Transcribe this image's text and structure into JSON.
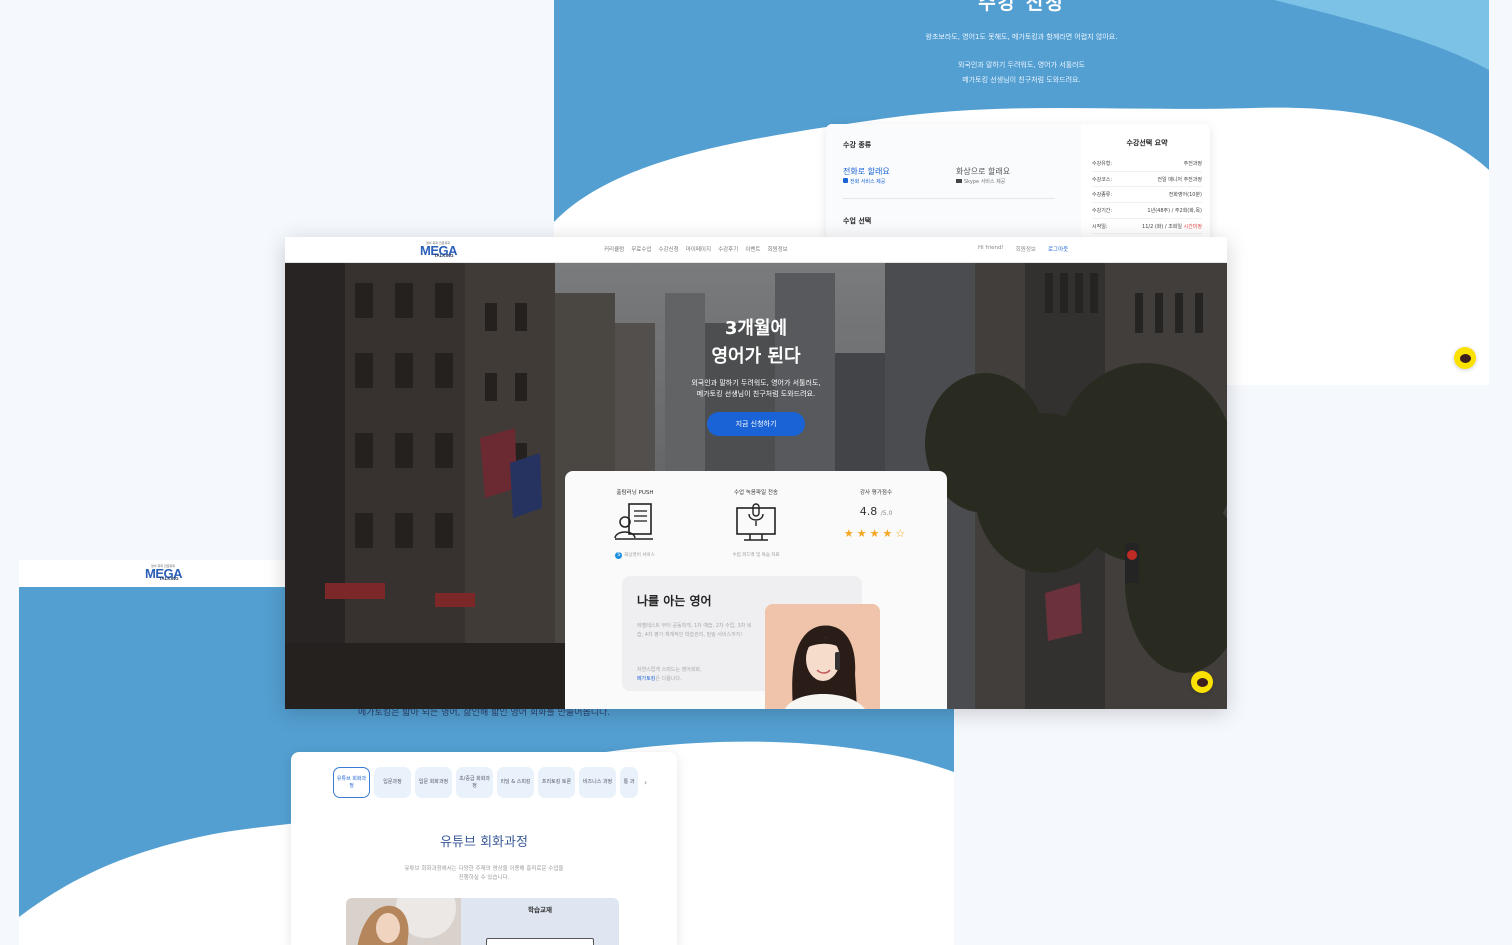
{
  "registration": {
    "title": "수강 신청",
    "subtitle1": "왕초보라도, 영어1도 못해도, 메가토킹과 함께라면 어렵지 않아요.",
    "subtitle2_line1": "외국인과 말하기 두려워도, 영어가 서툴러도",
    "subtitle2_line2": "메가토킹 선생님이 친구처럼 도와드려요.",
    "type_label": "수강 종류",
    "option_phone": "전화로 할래요",
    "option_phone_sub": "전화 서비스 제공",
    "option_video": "화상으로 할래요",
    "option_video_sub": "Skype 서비스 제공",
    "class_label": "수업 선택",
    "summary_title": "수강선택 요약",
    "summary_rows": [
      {
        "k": "수강유형:",
        "v": "주전과정",
        "red": ""
      },
      {
        "k": "수강코스:",
        "v": "전일 매니저 주전과정",
        "red": ""
      },
      {
        "k": "수강종류:",
        "v": "전화영어(10분)",
        "red": ""
      },
      {
        "k": "수강기간:",
        "v": "1년(48주) / 주2회(화,목)",
        "red": ""
      },
      {
        "k": "시작일:",
        "v": "11/2 (화) / 조회일 ",
        "red": "시간미정"
      }
    ]
  },
  "main": {
    "logo_tagline": "영어 회화 전문회화",
    "logo_mega": "MEGA",
    "logo_talking": "TALKING",
    "nav": [
      "커리큘럼",
      "무료수업",
      "수강신청",
      "마이페이지",
      "수강후기",
      "이벤트",
      "회원정보"
    ],
    "greeting": "Hi friend!",
    "member_info": "회원정보",
    "logout": "로그아웃",
    "hero_title_line1": "3개월에",
    "hero_title_line2": "영어가 된다",
    "hero_sub_line1": "외국인과 말하기 두려워도, 영어가 서툴러도,",
    "hero_sub_line2": "메가토킹 선생님이 친구처럼 도와드려요.",
    "cta": "지금 신청하기",
    "features": [
      {
        "title": "출탐러닝 PUSH",
        "sub": "화상영어 서비스"
      },
      {
        "title": "수업 녹음파일 전송",
        "sub": "수업 피드백 및 복습 자료"
      },
      {
        "title": "강사 평가점수",
        "sub": ""
      }
    ],
    "rating_value": "4.8",
    "rating_of": "/5.0",
    "rating_stars": 4.5,
    "know_title": "나를 아는 영어",
    "know_desc": "레벨테스트 부터 공동학개, 1차 예습, 2차 수업, 3차 복습, 4차 평가 체계적인 학습관리, 밀링 서비스까지!",
    "know_desc2": "자연스럽게 스며드는 영어회화,",
    "know_brand": "메가토킹",
    "know_desc2_end": "은 다릅니다."
  },
  "courses": {
    "logo_tagline": "영어 회화 전문회화",
    "logo_mega": "MEGA",
    "logo_talking": "TALKING",
    "tagline": "메가토킹은 밟아 되는 영어, 삶인해 밟인 영어 회화를 만들어옵니다.",
    "tabs": [
      "유튜브 회화과정",
      "입문과정",
      "입문 회화과정",
      "초/중급 회화과정",
      "리딩 & 스피킹",
      "프리토킹 토론",
      "비즈니스 과정",
      "통 과"
    ],
    "tab_more": "›",
    "course_title": "유튜브 회화과정",
    "course_desc_line1": "유튜브 회화과정에서는 다양한 주제의 영상을 이용해 흥미로운 수업을",
    "course_desc_line2": "진행하실 수 있습니다.",
    "textbook_label": "학습교재"
  },
  "colors": {
    "brand_blue": "#1a63d6",
    "wave_blue": "#4f9fd3",
    "kakao_yellow": "#fae100",
    "star": "#f5a623"
  },
  "icons": [
    "kakao-chat-icon",
    "phone-icon",
    "video-camera-icon",
    "skype-icon",
    "push-learning-icon",
    "recording-monitor-icon",
    "star-icon",
    "chevron-right-icon"
  ]
}
